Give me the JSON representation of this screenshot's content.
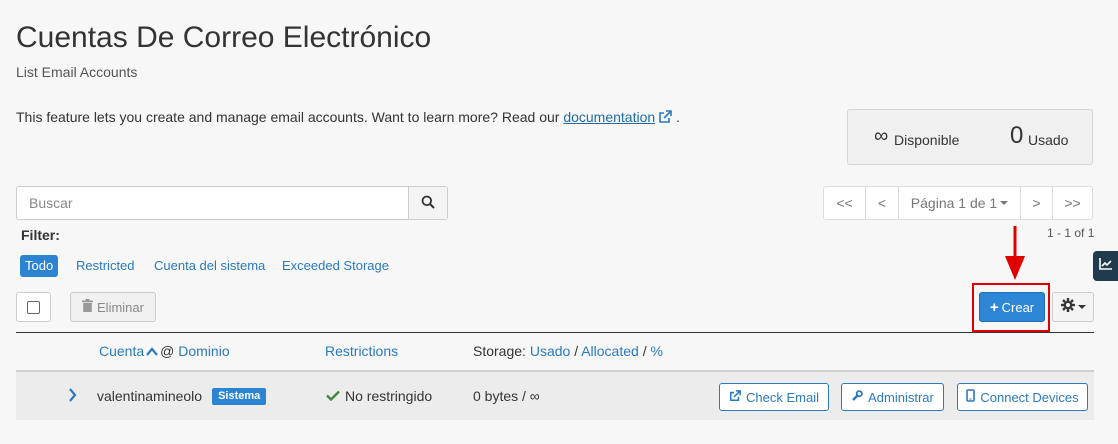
{
  "page": {
    "title": "Cuentas De Correo Electrónico",
    "subtitle": "List Email Accounts",
    "intro_text": "This feature lets you create and manage email accounts. Want to learn more? Read our ",
    "intro_link": "documentation",
    "intro_end": "."
  },
  "stats": {
    "available_value": "∞",
    "available_label": "Disponible",
    "used_value": "0",
    "used_label": "Usado"
  },
  "search": {
    "placeholder": "Buscar"
  },
  "pagination": {
    "first": "<<",
    "prev": "<",
    "page_label": "Página 1 de 1",
    "next": ">",
    "last": ">>",
    "range": "1 - 1 of 1"
  },
  "filter": {
    "label": "Filter:",
    "options": [
      "Todo",
      "Restricted",
      "Cuenta del sistema",
      "Exceeded Storage"
    ],
    "active": "Todo"
  },
  "toolbar": {
    "delete_label": "Eliminar",
    "create_label": "Crear"
  },
  "table": {
    "col_account": "Cuenta",
    "col_at": "@",
    "col_domain": "Dominio",
    "col_restrictions": "Restrictions",
    "col_storage_prefix": "Storage:",
    "col_storage_used": "Usado",
    "col_storage_sep1": "/",
    "col_storage_allocated": "Allocated",
    "col_storage_sep2": "/",
    "col_storage_pct": "%",
    "rows": [
      {
        "account": "valentinamineolo",
        "badge": "Sistema",
        "restriction": "No restringido",
        "storage": "0 bytes / ∞",
        "actions": [
          "Check Email",
          "Administrar",
          "Connect Devices"
        ]
      }
    ]
  },
  "colors": {
    "accent": "#2b84d2",
    "link": "#2a7ac0",
    "highlight": "#e00000",
    "ok": "#3c8b3c"
  }
}
